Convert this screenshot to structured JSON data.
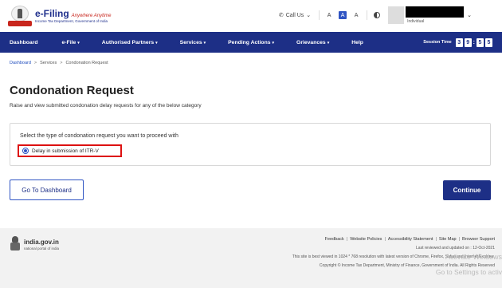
{
  "header": {
    "brand_name": "e-Filing",
    "brand_tag": "Anywhere Anytime",
    "brand_sub": "Income Tax Department, Government of India",
    "call_us": "Call Us",
    "font_decrease": "A",
    "font_default": "A",
    "font_increase": "A",
    "user_role": "Individual"
  },
  "nav": {
    "items": [
      {
        "label": "Dashboard",
        "caret": ""
      },
      {
        "label": "e-File",
        "caret": "▾"
      },
      {
        "label": "Authorised Partners",
        "caret": "▾"
      },
      {
        "label": "Services",
        "caret": "▾"
      },
      {
        "label": "Pending Actions",
        "caret": "▾"
      },
      {
        "label": "Grievances",
        "caret": "▾"
      },
      {
        "label": "Help",
        "caret": ""
      }
    ],
    "session_label": "Session Time",
    "session_digits": [
      "3",
      "9",
      "5",
      "5"
    ]
  },
  "breadcrumb": {
    "items": [
      "Dashboard",
      "Services",
      "Condonation Request"
    ]
  },
  "page": {
    "title": "Condonation Request",
    "description": "Raise and view submitted condonation delay requests for any of the below category"
  },
  "form": {
    "question": "Select the type of condonation request you want to proceed with",
    "option_label": "Delay in submission of ITR-V",
    "option_selected": true
  },
  "buttons": {
    "dashboard": "Go To Dashboard",
    "continue": "Continue"
  },
  "footer": {
    "domain": "india.gov.in",
    "tag": "national portal of india",
    "links": [
      "Feedback",
      "Website Policies",
      "Accessibility Statement",
      "Site Map",
      "Browser Support"
    ],
    "updated": "Last reviewed and updated on : 12-Oct-2021",
    "best_viewed": "This site is best viewed in 1024 * 768 resolution with latest version of Chrome, Firefox, Safari and Internet Explorer.",
    "copyright": "Copyright © Income Tax Department, Ministry of Finance, Government of India. All Rights Reserved"
  },
  "watermark": {
    "line1": "Activate Windows",
    "line2": "Go to Settings to activ"
  }
}
